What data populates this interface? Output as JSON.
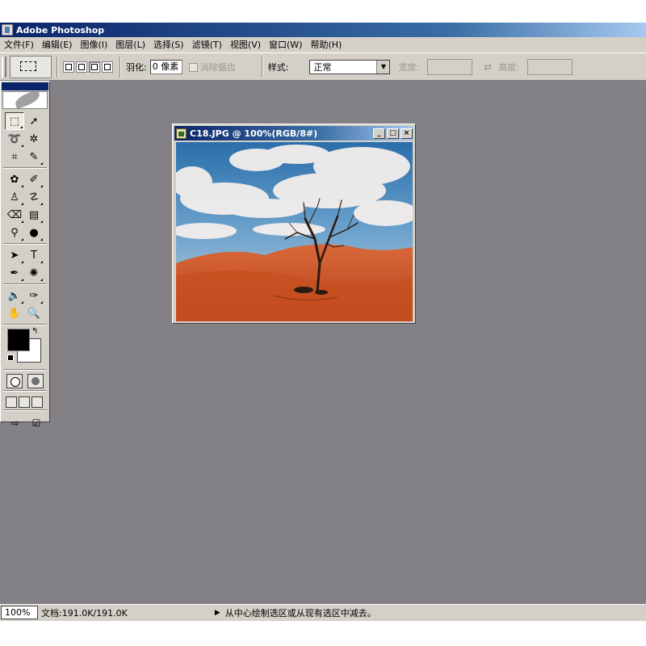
{
  "app": {
    "title": "Adobe Photoshop"
  },
  "menu": {
    "items": [
      "文件(F)",
      "编辑(E)",
      "图像(I)",
      "图层(L)",
      "选择(S)",
      "滤镜(T)",
      "视图(V)",
      "窗口(W)",
      "帮助(H)"
    ]
  },
  "options": {
    "feather_label": "羽化:",
    "feather_value": "0 像素",
    "antialias_label": "消除锯齿",
    "style_label": "样式:",
    "style_value": "正常",
    "width_label": "宽度:",
    "height_label": "高度:"
  },
  "document": {
    "title": "C18.JPG @ 100%(RGB/8#)",
    "minimize": "_",
    "maximize": "□",
    "close": "×"
  },
  "status": {
    "zoom": "100%",
    "doc_size": "文档:191.0K/191.0K",
    "hint": "从中心绘制选区或从现有选区中减去。"
  },
  "tools": {
    "icons": [
      "marquee-icon",
      "move-icon",
      "lasso-icon",
      "magic-wand-icon",
      "crop-icon",
      "slice-icon",
      "healing-brush-icon",
      "brush-icon",
      "clone-stamp-icon",
      "history-brush-icon",
      "eraser-icon",
      "gradient-icon",
      "dodge-icon",
      "blur-icon",
      "path-selection-icon",
      "type-icon",
      "pen-icon",
      "custom-shape-icon",
      "notes-icon",
      "eyedropper-icon",
      "hand-icon",
      "zoom-icon"
    ]
  },
  "colors": {
    "foreground": "#000000",
    "background": "#ffffff",
    "workspace": "#838086"
  }
}
